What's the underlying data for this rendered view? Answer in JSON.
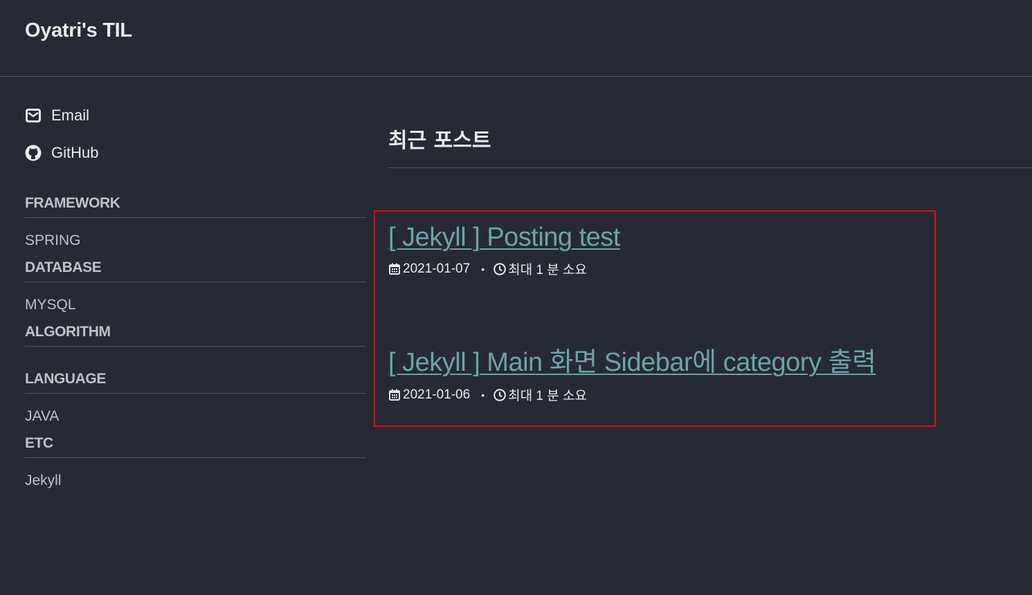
{
  "header": {
    "site_title": "Oyatri's TIL"
  },
  "sidebar": {
    "author_links": [
      {
        "label": "Email",
        "icon": "envelope-icon"
      },
      {
        "label": "GitHub",
        "icon": "github-icon"
      }
    ],
    "categories": [
      {
        "title": "FRAMEWORK",
        "items": [
          "SPRING"
        ]
      },
      {
        "title": "DATABASE",
        "items": [
          "MYSQL"
        ]
      },
      {
        "title": "ALGORITHM",
        "items": []
      },
      {
        "title": "LANGUAGE",
        "items": [
          "JAVA"
        ]
      },
      {
        "title": "ETC",
        "items": [
          "Jekyll"
        ]
      }
    ]
  },
  "main": {
    "page_title": "최근 포스트",
    "posts": [
      {
        "title": "[ Jekyll ] Posting test",
        "date": "2021-01-07",
        "read_time": "최대 1 분 소요"
      },
      {
        "title": "[ Jekyll ] Main 화면 Sidebar에 category 출력",
        "date": "2021-01-06",
        "read_time": "최대 1 분 소요"
      }
    ],
    "meta_separator": "•"
  },
  "colors": {
    "background": "#252a34",
    "text": "#eaeaea",
    "muted": "#bfc3c9",
    "link": "#6ba4a8",
    "border": "#51555d",
    "highlight": "#e01010"
  }
}
